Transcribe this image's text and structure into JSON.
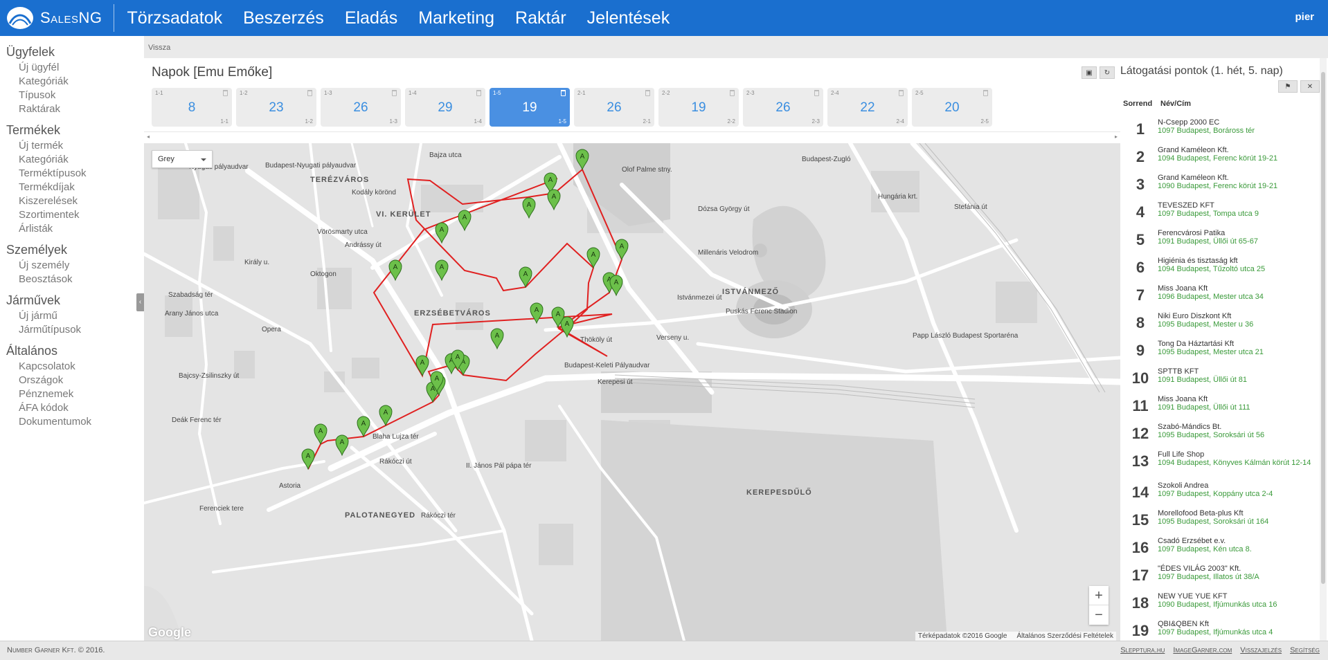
{
  "app": {
    "brand": "SalesNG",
    "user": "pier"
  },
  "nav": [
    "Törzsadatok",
    "Beszerzés",
    "Eladás",
    "Marketing",
    "Raktár",
    "Jelentések"
  ],
  "sidebar": [
    {
      "title": "Ügyfelek",
      "items": [
        "Új ügyfél",
        "Kategóriák",
        "Típusok",
        "Raktárak"
      ]
    },
    {
      "title": "Termékek",
      "items": [
        "Új termék",
        "Kategóriák",
        "Terméktípusok",
        "Termékdíjak",
        "Kiszerelések",
        "Szortimentek",
        "Árlisták"
      ]
    },
    {
      "title": "Személyek",
      "items": [
        "Új személy",
        "Beosztások"
      ]
    },
    {
      "title": "Járművek",
      "items": [
        "Új jármű",
        "Járműtípusok"
      ]
    },
    {
      "title": "Általános",
      "items": [
        "Kapcsolatok",
        "Országok",
        "Pénznemek",
        "ÁFA kódok",
        "Dokumentumok"
      ]
    }
  ],
  "back_label": "Vissza",
  "title": "Napok [Emu Emőke]",
  "days": [
    {
      "code": "1-1",
      "num": "8",
      "active": false
    },
    {
      "code": "1-2",
      "num": "23",
      "active": false
    },
    {
      "code": "1-3",
      "num": "26",
      "active": false
    },
    {
      "code": "1-4",
      "num": "29",
      "active": false
    },
    {
      "code": "1-5",
      "num": "19",
      "active": true
    },
    {
      "code": "2-1",
      "num": "26",
      "active": false
    },
    {
      "code": "2-2",
      "num": "19",
      "active": false
    },
    {
      "code": "2-3",
      "num": "26",
      "active": false
    },
    {
      "code": "2-4",
      "num": "22",
      "active": false
    },
    {
      "code": "2-5",
      "num": "20",
      "active": false
    }
  ],
  "map": {
    "style_select": "Grey",
    "google": "Google",
    "attribution": [
      "Térképadatok ©2016 Google",
      "Általános Szerződési Feltételek"
    ],
    "zoom_in": "+",
    "zoom_out": "−",
    "route_color": "#e02020",
    "marker_label": "A",
    "labels": [
      "TERÉZVÁROS",
      "VI. KERÜLET",
      "ERZSÉBETVÁROS",
      "ISTVÁNMEZŐ",
      "KEREPESDŰLŐ",
      "PALOTANEGYED",
      "Nyugati pályaudvar",
      "Budapest-Nyugati pályaudvar",
      "Oktogon",
      "Opera",
      "Kodály körönd",
      "Vörösmarty utca",
      "Bajza utca",
      "Budapest-Zugló",
      "Millenáris Velodrom",
      "Puskás Ferenc Stadion",
      "Papp László Budapest Sportaréna",
      "Budapest-Keleti Pályaudvar",
      "Kerepesi út",
      "Dózsa György út",
      "Thököly út",
      "Rákóczi út",
      "Blaha Lujza tér",
      "II. János Pál pápa tér",
      "Astoria",
      "Deák Ferenc tér",
      "Arany János utca",
      "Bajcsy-Zsilinszky út",
      "Ferenciek tere",
      "Rákóczi tér",
      "Hungária krt.",
      "Andrássy út",
      "Király u.",
      "Szabadság tér",
      "Olof Palme stny.",
      "Istvánmezei út",
      "Verseny u.",
      "Stefánia út"
    ]
  },
  "right_panel": {
    "title": "Látogatási pontok (1. hét, 5. nap)",
    "col_order": "Sorrend",
    "col_name": "Név/Cím",
    "rows": [
      {
        "n": "1",
        "name": "N-Csepp 2000 EC",
        "addr": "1097 Budapest, Boráross tér"
      },
      {
        "n": "2",
        "name": "Grand Kaméleon Kft.",
        "addr": "1094 Budapest, Ferenc körút 19-21"
      },
      {
        "n": "3",
        "name": "Grand Kaméleon Kft.",
        "addr": "1090 Budapest, Ferenc körút 19-21"
      },
      {
        "n": "4",
        "name": "TEVESZED KFT",
        "addr": "1097 Budapest, Tompa utca 9"
      },
      {
        "n": "5",
        "name": "Ferencvárosi Patika",
        "addr": "1091 Budapest, Üllői út 65-67"
      },
      {
        "n": "6",
        "name": "Higiénia és tisztaság kft",
        "addr": "1094 Budapest, Tűzoltó utca 25"
      },
      {
        "n": "7",
        "name": "Miss Joana Kft",
        "addr": "1096 Budapest, Mester utca 34"
      },
      {
        "n": "8",
        "name": "Niki Euro Diszkont Kft",
        "addr": "1095 Budapest, Mester u 36"
      },
      {
        "n": "9",
        "name": "Tong Da Háztartási Kft",
        "addr": "1095 Budapest, Mester utca 21"
      },
      {
        "n": "10",
        "name": "SPTTB KFT",
        "addr": "1091 Budapest, Üllői út 81"
      },
      {
        "n": "11",
        "name": "Miss Joana Kft",
        "addr": "1091 Budapest, Üllői út 111"
      },
      {
        "n": "12",
        "name": "Szabó-Mándics Bt.",
        "addr": "1095 Budapest, Soroksári út 56"
      },
      {
        "n": "13",
        "name": "Full Life Shop",
        "addr": "1094 Budapest, Könyves Kálmán körút 12-14"
      },
      {
        "n": "14",
        "name": "Szokoli Andrea",
        "addr": "1097 Budapest, Koppány utca 2-4"
      },
      {
        "n": "15",
        "name": "Morellofood Beta-plus Kft",
        "addr": "1095 Budapest, Soroksári út 164"
      },
      {
        "n": "16",
        "name": "Csadó Erzsébet e.v.",
        "addr": "1097 Budapest, Kén utca 8."
      },
      {
        "n": "17",
        "name": "\"ÉDES VILÁG 2003\" Kft.",
        "addr": "1097 Budapest, Illatos út 38/A"
      },
      {
        "n": "18",
        "name": "NEW YUE YUE KFT",
        "addr": "1090 Budapest, Ifjúmunkás utca 16"
      },
      {
        "n": "19",
        "name": "QBI&QBEN Kft",
        "addr": "1097 Budapest, Ifjúmunkás utca 4"
      }
    ]
  },
  "footer": {
    "copyright": "Number Garner Kft. © 2016.",
    "links": [
      "Slepptura.hu",
      "ImageGarner.com",
      "Visszajelzés",
      "Segítség"
    ]
  }
}
